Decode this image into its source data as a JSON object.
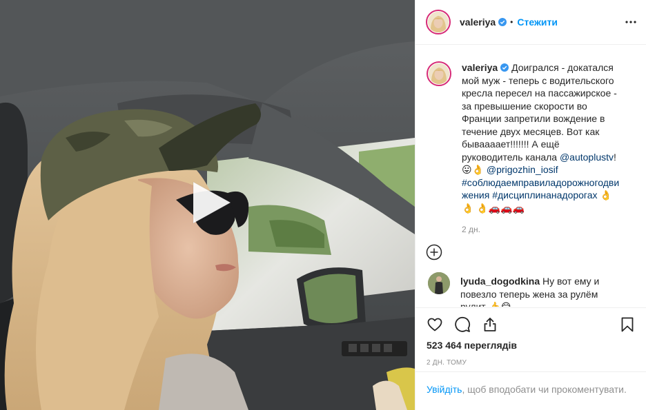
{
  "post": {
    "author": "valeriya",
    "follow_label": "Стежити",
    "dot": "•",
    "caption": {
      "author": "valeriya",
      "text_part1": "Доигрался - докатался мой муж - теперь с водительского кресла пересел на пассажирское - за превышение скорости во Франции запретили вождение в течение двух месяцев. Вот как бываааает!!!!!!! А ещё руководитель канала ",
      "mention1": "@autoplustv",
      "text_part2": "! 😛👌 ",
      "mention2": "@prigozhin_iosif",
      "hashtag1": "#соблюдаемправиладорожногодвижения",
      "space": " ",
      "hashtag2": "#дисциплинанадорогах",
      "text_part3": " 👌👌 👌🚗🚗🚗"
    },
    "caption_time": "2 дн.",
    "comment": {
      "author": "lyuda_dogodkina",
      "text": "Ну вот ему и повезло теперь жена за рулём рулит 👍😂"
    },
    "views": "523 464 переглядів",
    "date": "2 дн. тому",
    "login_prompt": {
      "link": "Увійдіть",
      "text": ", щоб вподобати чи прокоментувати."
    }
  },
  "icons": {
    "verified": "verified-badge-icon",
    "more": "more-options-icon",
    "load_more": "plus-circle-icon",
    "like": "heart-icon",
    "comment": "comment-icon",
    "share": "share-icon",
    "save": "bookmark-icon",
    "play": "play-icon"
  },
  "colors": {
    "link": "#00376b",
    "follow": "#0095f6",
    "story_ring": "#d62976",
    "secondary_text": "#8e8e8e"
  }
}
